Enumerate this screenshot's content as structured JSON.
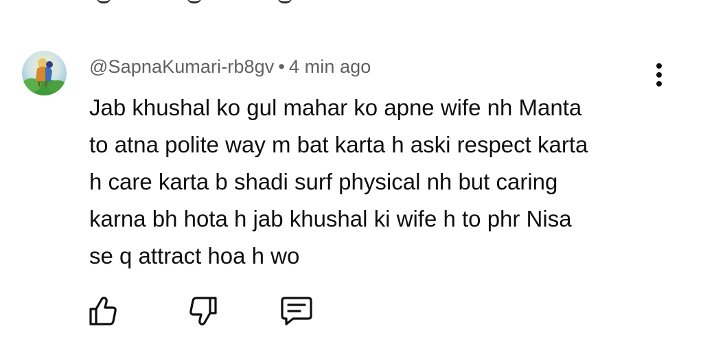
{
  "comment": {
    "author": "@SapnaKumari-rb8gv",
    "separator": "•",
    "timestamp": "4 min ago",
    "text_lines": [
      "Jab khushal ko gul mahar ko apne wife nh Manta",
      "to atna polite way m bat karta h aski respect karta",
      "h care karta b shadi surf physical nh but caring",
      "karna bh hota h jab khushal ki wife h to phr Nisa",
      "se q attract hoa h wo"
    ]
  },
  "icons": {
    "avatar": "avatar-image",
    "more": "more-vert-icon",
    "like": "thumbs-up-icon",
    "dislike": "thumbs-down-icon",
    "reply": "comment-reply-icon"
  },
  "colors": {
    "text": "#0f0f0f",
    "meta": "#606060",
    "icon": "#0f0f0f"
  }
}
